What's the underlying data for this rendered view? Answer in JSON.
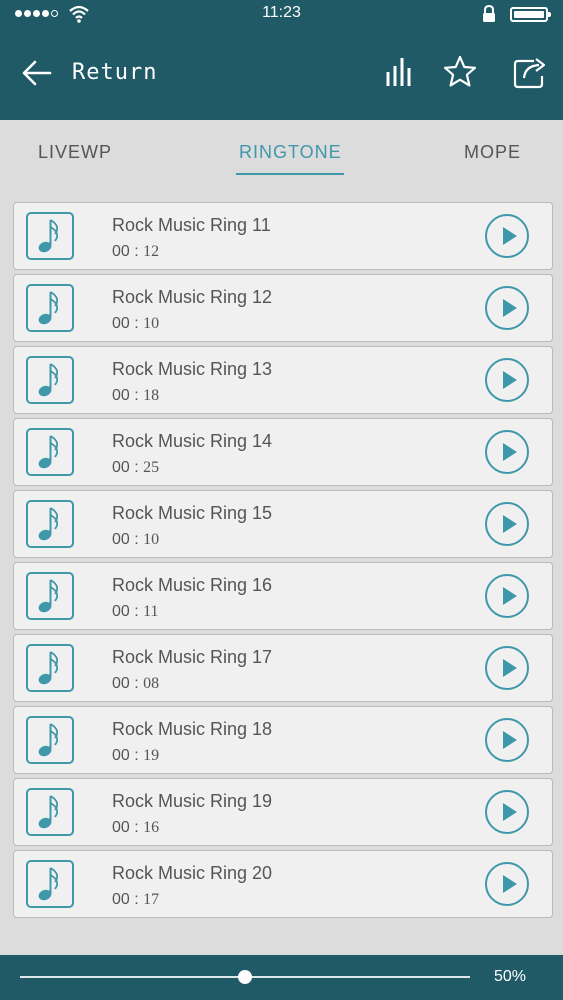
{
  "status_bar": {
    "time": "11:23"
  },
  "header": {
    "return_label": "Return"
  },
  "tabs": [
    {
      "label": "LIVEWP",
      "active": false
    },
    {
      "label": "RINGTONE",
      "active": true
    },
    {
      "label": "MOPE",
      "active": false
    }
  ],
  "ringtones": [
    {
      "title": "Rock Music Ring 11",
      "min": "00 :",
      "sec": "12"
    },
    {
      "title": "Rock Music Ring 12",
      "min": "00 :",
      "sec": "10"
    },
    {
      "title": "Rock Music Ring 13",
      "min": "00 :",
      "sec": "18"
    },
    {
      "title": "Rock Music Ring 14",
      "min": "00 :",
      "sec": "25"
    },
    {
      "title": "Rock Music Ring 15",
      "min": "00 :",
      "sec": "10"
    },
    {
      "title": "Rock Music Ring 16",
      "min": "00 :",
      "sec": "11"
    },
    {
      "title": "Rock Music Ring 17",
      "min": "00 :",
      "sec": "08"
    },
    {
      "title": "Rock Music Ring 18",
      "min": "00 :",
      "sec": "19"
    },
    {
      "title": "Rock Music Ring 19",
      "min": "00 :",
      "sec": "16"
    },
    {
      "title": "Rock Music Ring 20",
      "min": "00 :",
      "sec": "17"
    }
  ],
  "volume": {
    "percent_label": "50%",
    "level": 0.5
  },
  "colors": {
    "header_bg": "#1f5a66",
    "accent": "#3f98aa",
    "list_bg": "#f0f0f0"
  },
  "icons": [
    "signal-dots-icon",
    "wifi-icon",
    "lock-icon",
    "battery-icon",
    "back-arrow-icon",
    "equalizer-icon",
    "star-icon",
    "share-icon",
    "music-note-icon",
    "play-icon"
  ]
}
